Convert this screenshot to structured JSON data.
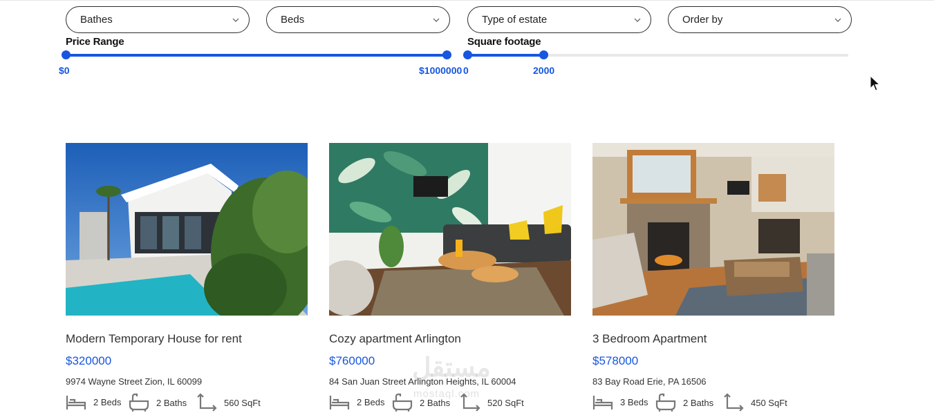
{
  "filters": {
    "bathes": "Bathes",
    "beds": "Beds",
    "estate_type": "Type of estate",
    "order_by": "Order by"
  },
  "price_range": {
    "title": "Price Range",
    "min_label": "$0",
    "max_label": "$1000000",
    "min": 0,
    "max": 1000000,
    "low": 0,
    "high": 1000000
  },
  "square_footage": {
    "title": "Square footage",
    "min_label": "0",
    "max_label": "2000",
    "low_fraction": 0.0,
    "high_fraction": 0.2
  },
  "listings": [
    {
      "title": "Modern Temporary House for rent",
      "price": "$320000",
      "address": "9974 Wayne Street Zion, IL 60099",
      "beds": "2 Beds",
      "baths": "2 Baths",
      "area": "560 SqFt"
    },
    {
      "title": "Cozy apartment Arlington",
      "price": "$760000",
      "address": "84 San Juan Street Arlington Heights, IL 60004",
      "beds": "2 Beds",
      "baths": "2 Baths",
      "area": "520 SqFt"
    },
    {
      "title": "3 Bedroom Apartment",
      "price": "$578000",
      "address": "83 Bay Road Erie, PA 16506",
      "beds": "3 Beds",
      "baths": "2 Baths",
      "area": "450 SqFt"
    }
  ],
  "watermark": {
    "main": "مستقل",
    "sub": "mostaql.com"
  },
  "colors": {
    "accent": "#1656e0",
    "track": "#e8e8e8"
  }
}
